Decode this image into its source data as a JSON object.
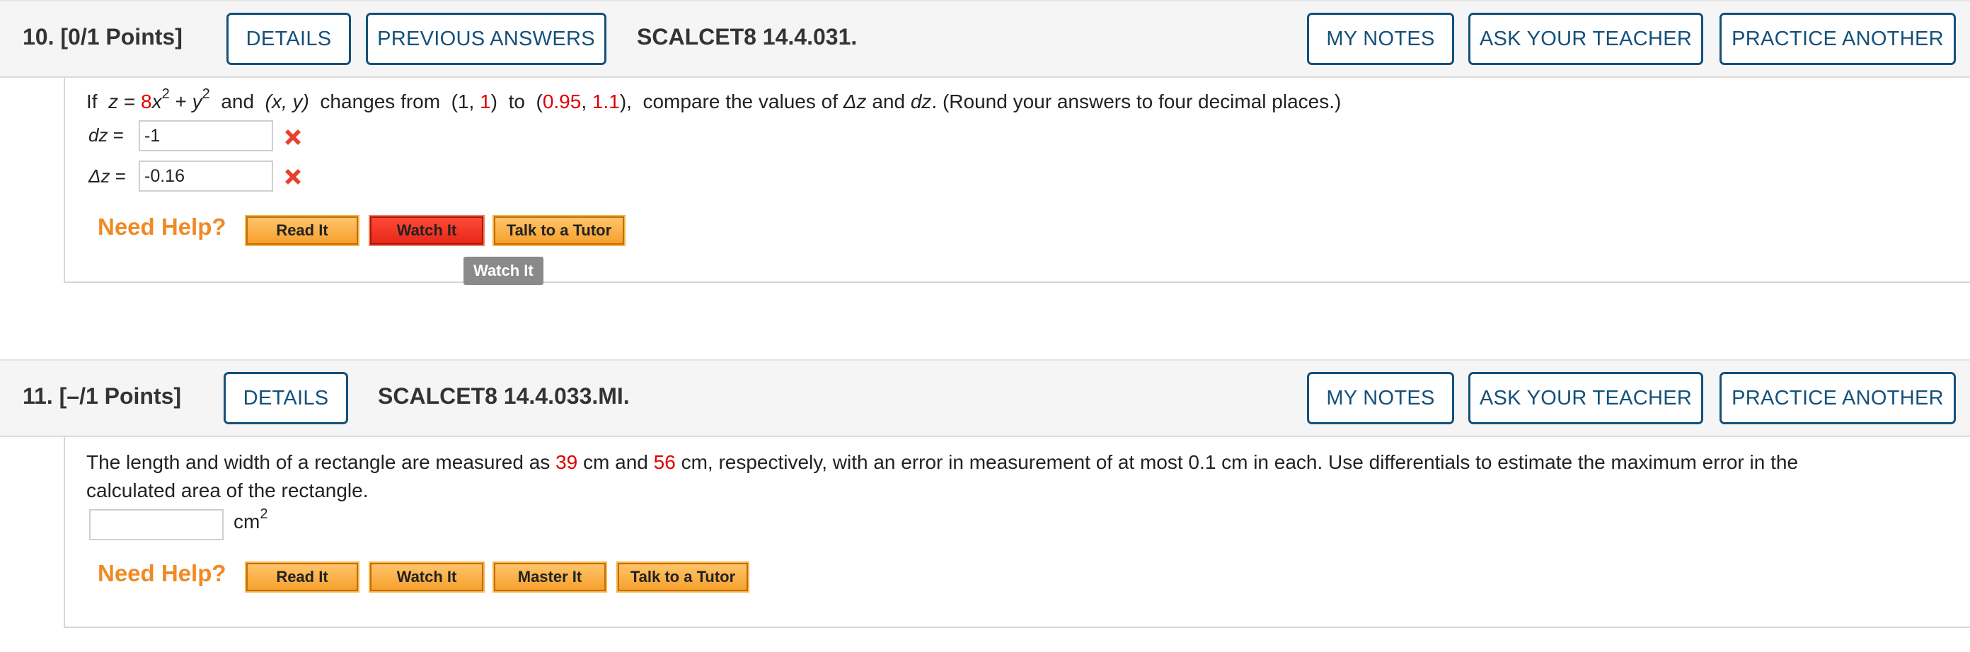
{
  "q10": {
    "number": "10.",
    "points": "[0/1 Points]",
    "details_label": "DETAILS",
    "previous_answers_label": "PREVIOUS ANSWERS",
    "code": "SCALCET8 14.4.031.",
    "my_notes_label": "MY NOTES",
    "ask_teacher_label": "ASK YOUR TEACHER",
    "practice_another_label": "PRACTICE ANOTHER",
    "prompt": {
      "if": "If",
      "z_var": "z",
      "equals": "=",
      "coef": "8",
      "x_var": "x",
      "exp1": "2",
      "plus": "+",
      "y_var": "y",
      "exp2": "2",
      "and1": "and",
      "xy": "(x, y)",
      "changes_from": "changes from",
      "open1": "(1,",
      "from_y": "1",
      "close1": ")",
      "to": "to",
      "open2": "(",
      "to_x": "0.95",
      "comma": ",",
      "to_y": "1.1",
      "close2": "),",
      "compare": "compare the values of",
      "delta_z": "Δz",
      "and2": "and",
      "dz": "dz",
      "round": ". (Round your answers to four decimal places.)"
    },
    "dz_label_var": "dz",
    "dz_label_eq": "=",
    "dz_value": "-1",
    "deltaz_label_var": "Δz",
    "deltaz_label_eq": "=",
    "deltaz_value": "-0.16",
    "need_help": "Need Help?",
    "read_it": "Read It",
    "watch_it": "Watch It",
    "talk_tutor": "Talk to a Tutor",
    "tooltip": "Watch It"
  },
  "q11": {
    "number": "11.",
    "points": "[–/1 Points]",
    "details_label": "DETAILS",
    "code": "SCALCET8 14.4.033.MI.",
    "my_notes_label": "MY NOTES",
    "ask_teacher_label": "ASK YOUR TEACHER",
    "practice_another_label": "PRACTICE ANOTHER",
    "prompt": {
      "part1": "The length and width of a rectangle are measured as",
      "length": "39",
      "part2": "cm and",
      "width": "56",
      "part3": "cm, respectively, with an error in measurement of at most 0.1 cm in each. Use differentials to estimate the maximum error in the",
      "line2": "calculated area of the rectangle."
    },
    "answer_value": "",
    "unit_base": "cm",
    "unit_exp": "2",
    "need_help": "Need Help?",
    "read_it": "Read It",
    "watch_it": "Watch It",
    "master_it": "Master It",
    "talk_tutor": "Talk to a Tutor"
  },
  "colors": {
    "accent_blue": "#15507a",
    "param_red": "#e00000",
    "help_orange": "#f08a24",
    "wrong_red": "#e8412f"
  }
}
